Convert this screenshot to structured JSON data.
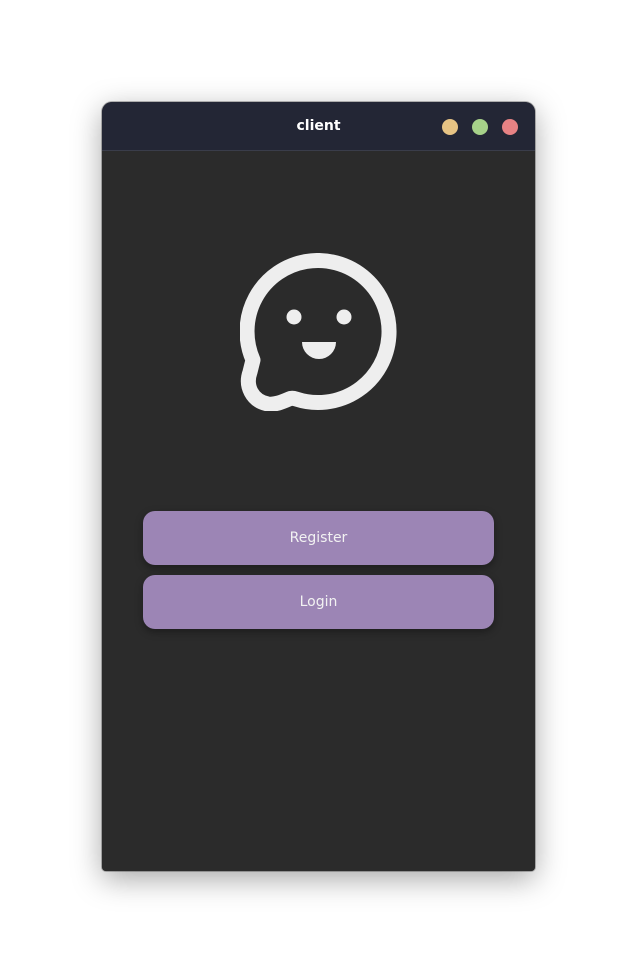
{
  "window": {
    "title": "client",
    "controls": {
      "minimize_color": "#e6c384",
      "maximize_color": "#a6d189",
      "close_color": "#e78284"
    }
  },
  "main": {
    "logo_icon": "smiling-chat-bubble-icon",
    "register_label": "Register",
    "login_label": "Login"
  },
  "colors": {
    "titlebar": "#232635",
    "background": "#2b2b2b",
    "button": "#9c85b5",
    "icon": "#eeeeee"
  }
}
